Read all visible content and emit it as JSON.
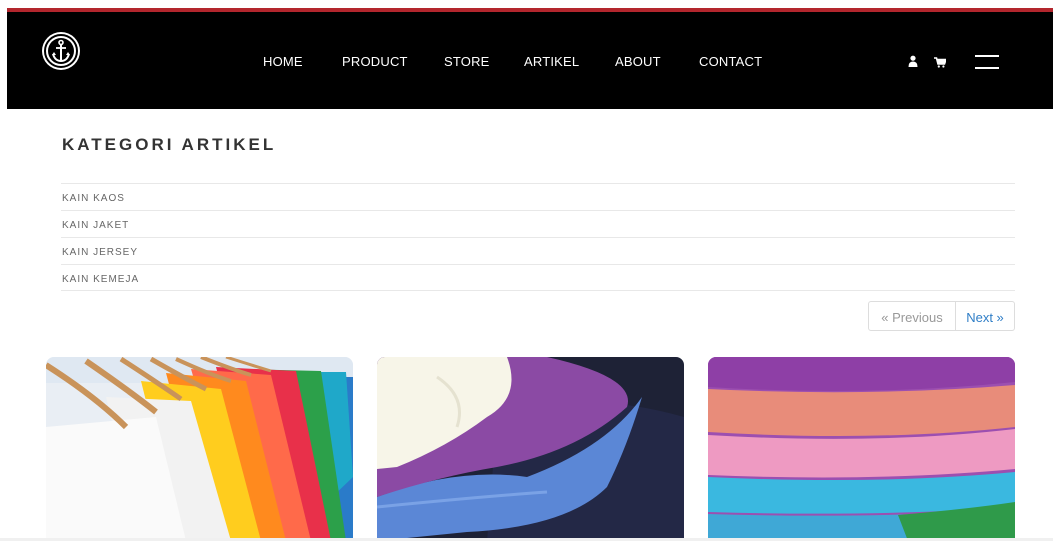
{
  "nav": {
    "items": [
      "HOME",
      "PRODUCT",
      "STORE",
      "ARTIKEL",
      "ABOUT",
      "CONTACT"
    ],
    "icons": [
      "anchor-logo",
      "user-icon",
      "cart-icon",
      "menu-icon"
    ]
  },
  "kategori": {
    "title": "KATEGORI ARTIKEL",
    "items": [
      "KAIN KAOS",
      "KAIN JAKET",
      "KAIN JERSEY",
      "KAIN KEMEJA"
    ]
  },
  "pagination": {
    "previous": "« Previous",
    "next": "Next »"
  },
  "colors": {
    "header_bg": "#000000",
    "accent_red": "#b3262d",
    "link_blue": "#2f7ec7"
  }
}
